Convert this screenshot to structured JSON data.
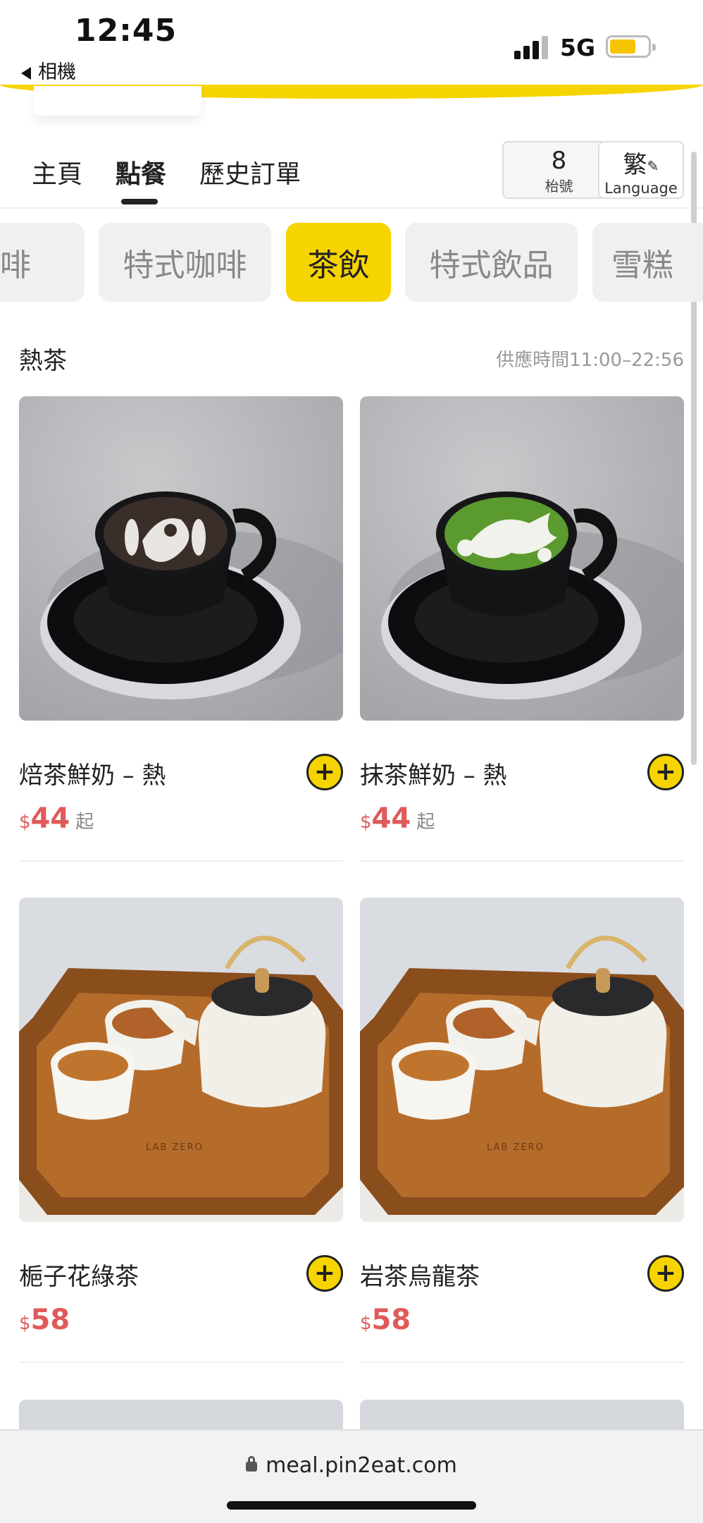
{
  "status_bar": {
    "time": "12:45",
    "back_app": "相機",
    "network": "5G"
  },
  "nav": {
    "tabs": [
      {
        "label": "主頁"
      },
      {
        "label": "點餐"
      },
      {
        "label": "歷史訂單"
      }
    ],
    "active_tab": "點餐",
    "table": {
      "number": "8",
      "label": "枱號"
    },
    "language": {
      "char": "繁",
      "label": "Language"
    }
  },
  "categories": [
    {
      "label": "咖啡"
    },
    {
      "label": "特式咖啡"
    },
    {
      "label": "茶飲"
    },
    {
      "label": "特式飲品"
    },
    {
      "label": "雪糕"
    }
  ],
  "active_category": "茶飲",
  "section": {
    "title": "熱茶",
    "hours": "供應時間11:00–22:56"
  },
  "products": [
    {
      "name": "焙茶鮮奶 – 熱",
      "currency": "$",
      "price": "44",
      "suffix": "起"
    },
    {
      "name": "抹茶鮮奶 – 熱",
      "currency": "$",
      "price": "44",
      "suffix": "起"
    },
    {
      "name": "梔子花綠茶",
      "currency": "$",
      "price": "58",
      "suffix": ""
    },
    {
      "name": "岩茶烏龍茶",
      "currency": "$",
      "price": "58",
      "suffix": ""
    }
  ],
  "tray_brand": "LAB ZERO",
  "browser": {
    "url": "meal.pin2eat.com"
  },
  "colors": {
    "accent": "#f6d400",
    "price": "#e05a5a",
    "inactive_pill": "#f0f0f0"
  }
}
